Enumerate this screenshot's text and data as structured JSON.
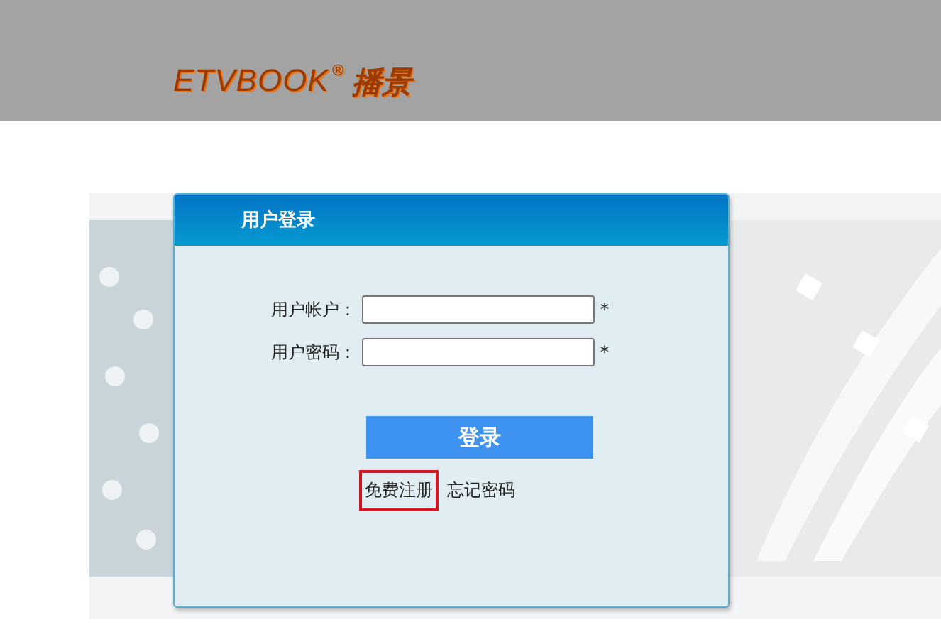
{
  "header": {
    "logo": "ETVBOOK",
    "logo_mark": "®",
    "logo_cn": "播景"
  },
  "login": {
    "title": "用户登录",
    "fields": [
      {
        "label": "用户帐户：",
        "required_mark": "*"
      },
      {
        "label": "用户密码：",
        "required_mark": "*"
      }
    ],
    "submit": "登录",
    "links": [
      {
        "label": "免费注册",
        "highlighted": true
      },
      {
        "label": "忘记密码",
        "highlighted": false
      }
    ]
  }
}
